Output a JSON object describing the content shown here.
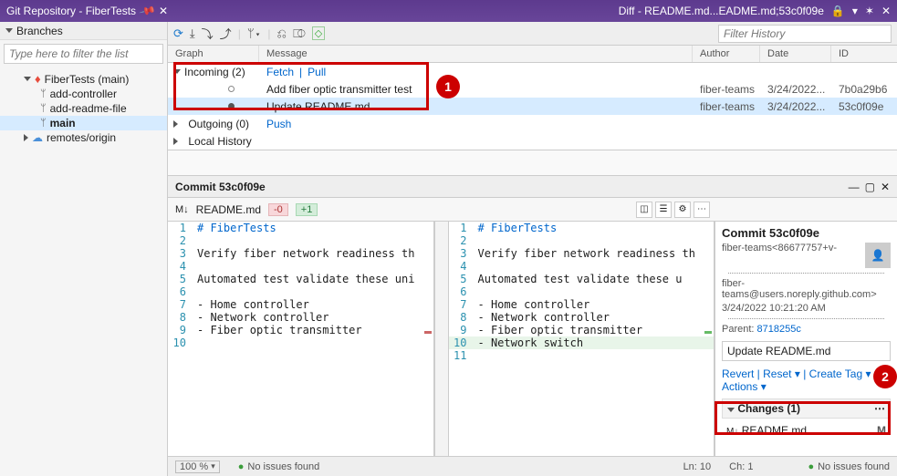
{
  "titlebar": {
    "left": "Git Repository - FiberTests",
    "right": "Diff - README.md...EADME.md;53c0f09e"
  },
  "sidebar": {
    "header": "Branches",
    "filter_placeholder": "Type here to filter the list",
    "repo": "FiberTests (main)",
    "branches": [
      "add-controller",
      "add-readme-file",
      "main"
    ],
    "remotes": "remotes/origin"
  },
  "toolbar": {
    "filter_history_placeholder": "Filter History"
  },
  "grid": {
    "cols": {
      "graph": "Graph",
      "message": "Message",
      "author": "Author",
      "date": "Date",
      "id": "ID"
    },
    "incoming_label": "Incoming (2)",
    "fetch": "Fetch",
    "pull": "Pull",
    "outgoing_label": "Outgoing (0)",
    "push": "Push",
    "localhist": "Local History",
    "rows": [
      {
        "msg": "Add fiber optic transmitter test",
        "author": "fiber-teams",
        "date": "3/24/2022...",
        "id": "7b0a29b6"
      },
      {
        "msg": "Update README.md",
        "author": "fiber-teams",
        "date": "3/24/2022...",
        "id": "53c0f09e"
      }
    ]
  },
  "commit": {
    "header": "Commit 53c0f09e",
    "file": "README.md",
    "minus": "-0",
    "plus": "+1",
    "left_lines": {
      "1": "# FiberTests",
      "2": "",
      "3": "Verify fiber network readiness th",
      "4": "",
      "5": "Automated test validate these uni",
      "6": "",
      "7": "- Home controller",
      "8": "- Network controller",
      "9": "- Fiber optic transmitter",
      "10": ""
    },
    "right_lines": {
      "1": "# FiberTests",
      "2": "",
      "3": "Verify fiber network readiness th",
      "4": "",
      "5": "Automated test validate these u",
      "6": "",
      "7": "- Home controller",
      "8": "- Network controller",
      "9": "- Fiber optic transmitter",
      "10": "- Network switch",
      "11": ""
    }
  },
  "commitSide": {
    "title": "Commit 53c0f09e",
    "author": "fiber-teams",
    "author_id": "<86677757+v-",
    "email": "fiber-teams@users.noreply.github.com>",
    "date": "3/24/2022 10:21:20 AM",
    "parent_label": "Parent: ",
    "parent": "8718255c",
    "message": "Update README.md",
    "revert": "Revert",
    "reset": "Reset",
    "createtag": "Create Tag",
    "actions": "Actions",
    "changes_hdr": "Changes (1)",
    "changed_file": "README.md",
    "mod": "M"
  },
  "status": {
    "zoom": "100 %",
    "issues": "No issues found",
    "ln": "Ln: 10",
    "ch": "Ch: 1",
    "issues2": "No issues found"
  }
}
